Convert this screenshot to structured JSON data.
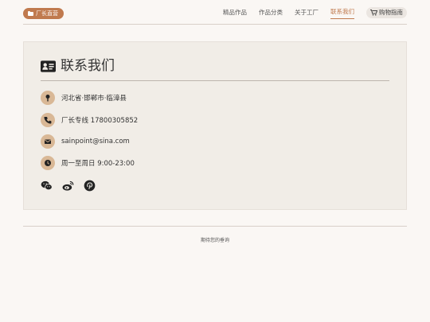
{
  "brand": {
    "label": "厂长直营",
    "icon": "folder-icon",
    "color": "#c07a4e"
  },
  "nav": {
    "items": [
      {
        "label": "精品作品"
      },
      {
        "label": "作品分类"
      },
      {
        "label": "关于工厂"
      },
      {
        "label": "联系我们",
        "active": true
      }
    ],
    "cart_label": "购物指南",
    "cart_icon": "cart-icon"
  },
  "contact": {
    "title": "联系我们",
    "title_icon": "id-card-icon",
    "address": "河北省·邯郸市·临漳县",
    "phone": "厂长专线 17800305852",
    "email": "sainpoint@sina.com",
    "hours": "周一至周日 9:00-23:00",
    "social_icons": [
      "wechat-icon",
      "weibo-icon",
      "pinterest-icon"
    ]
  },
  "footer": {
    "text": "期待您的垂询"
  },
  "colors": {
    "accent": "#c07a4e",
    "icon_circle": "#d9b896",
    "card_bg": "#f1ede7",
    "page_bg": "#faf7f4"
  }
}
